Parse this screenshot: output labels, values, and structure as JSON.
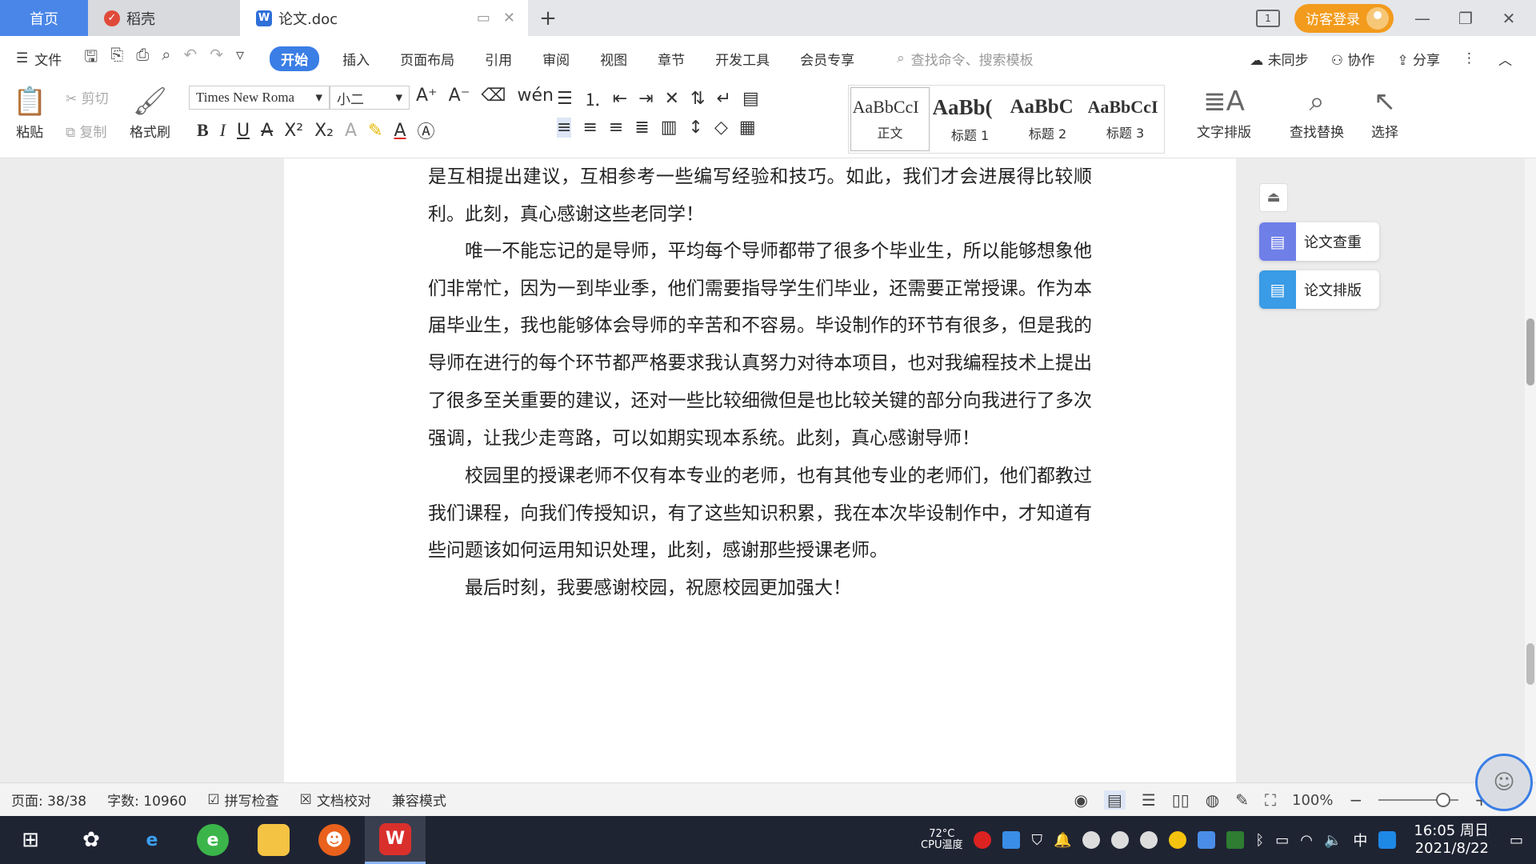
{
  "tabs": {
    "home": "首页",
    "docer": "稻壳",
    "document": "论文.doc"
  },
  "titlebar": {
    "login": "访客登录"
  },
  "menu": {
    "file": "文件",
    "items": [
      "开始",
      "插入",
      "页面布局",
      "引用",
      "审阅",
      "视图",
      "章节",
      "开发工具",
      "会员专享"
    ],
    "search_placeholder": "查找命令、搜索模板",
    "sync": "未同步",
    "collab": "协作",
    "share": "分享"
  },
  "ribbon": {
    "paste": "粘贴",
    "cut": "剪切",
    "copy": "复制",
    "format_painter": "格式刷",
    "font_name": "Times New Roma",
    "font_size": "小二",
    "styles": [
      {
        "sample": "AaBbCcI",
        "label": "正文"
      },
      {
        "sample": "AaBb(",
        "label": "标题 1"
      },
      {
        "sample": "AaBbC",
        "label": "标题 2"
      },
      {
        "sample": "AaBbCcI",
        "label": "标题 3"
      }
    ],
    "text_layout": "文字排版",
    "find_replace": "查找替换",
    "select": "选择"
  },
  "document": {
    "paragraphs": [
      "是互相提出建议，互相参考一些编写经验和技巧。如此，我们才会进展得比较顺利。此刻，真心感谢这些老同学！",
      "唯一不能忘记的是导师，平均每个导师都带了很多个毕业生，所以能够想象他们非常忙，因为一到毕业季，他们需要指导学生们毕业，还需要正常授课。作为本届毕业生，我也能够体会导师的辛苦和不容易。毕设制作的环节有很多，但是我的导师在进行的每个环节都严格要求我认真努力对待本项目，也对我编程技术上提出了很多至关重要的建议，还对一些比较细微但是也比较关键的部分向我进行了多次强调，让我少走弯路，可以如期实现本系统。此刻，真心感谢导师！",
      "校园里的授课老师不仅有本专业的老师，也有其他专业的老师们，他们都教过我们课程，向我们传授知识，有了这些知识积累，我在本次毕设制作中，才知道有些问题该如何运用知识处理，此刻，感谢那些授课老师。",
      "最后时刻，我要感谢校园，祝愿校园更加强大！"
    ]
  },
  "side_panel": {
    "check": "论文查重",
    "layout": "论文排版"
  },
  "status": {
    "page": "页面: 38/38",
    "words": "字数: 10960",
    "spell": "拼写检查",
    "proof": "文档校对",
    "compat": "兼容模式",
    "zoom": "100%"
  },
  "taskbar": {
    "cpu_temp": "72°C",
    "cpu_label": "CPU温度",
    "ime": "中",
    "time": "16:05 周日",
    "date": "2021/8/22"
  }
}
